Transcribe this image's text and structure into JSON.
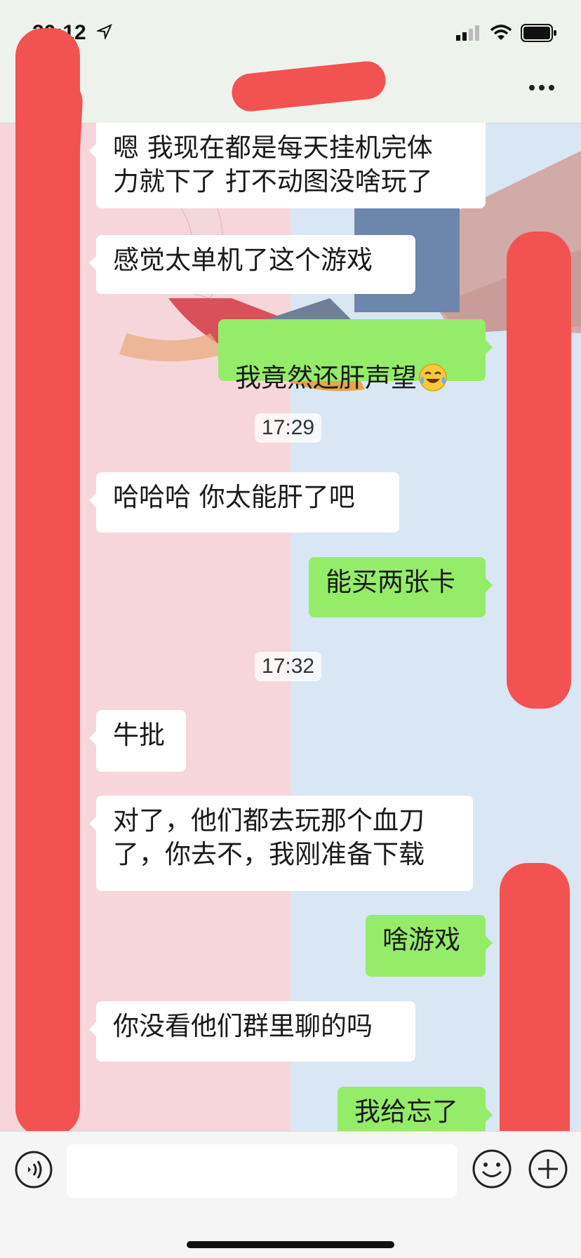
{
  "status_bar": {
    "time": "20:12"
  },
  "chat": {
    "messages": [
      {
        "side": "left",
        "text": "嗯 我现在都是每天挂机完体\n力就下了 打不动图没啥玩了"
      },
      {
        "side": "left",
        "text": "感觉太单机了这个游戏"
      },
      {
        "side": "right",
        "text": "我竟然还肝声望",
        "emoji": "laughing-crying-emoji"
      },
      {
        "side": "time",
        "text": "17:29"
      },
      {
        "side": "left",
        "text": "哈哈哈 你太能肝了吧"
      },
      {
        "side": "right",
        "text": "能买两张卡"
      },
      {
        "side": "time",
        "text": "17:32"
      },
      {
        "side": "left",
        "text": "牛批"
      },
      {
        "side": "left",
        "text": "对了，他们都去玩那个血刀\n了，你去不，我刚准备下载"
      },
      {
        "side": "right",
        "text": "啥游戏"
      },
      {
        "side": "left",
        "text": "你没看他们群里聊的吗"
      },
      {
        "side": "right",
        "text": "我给忘了"
      }
    ]
  },
  "colors": {
    "incoming_bubble": "#ffffff",
    "outgoing_bubble": "#95ec69",
    "redaction": "#f25252"
  },
  "icons": [
    "location-arrow-icon",
    "signal-icon",
    "wifi-icon",
    "battery-icon",
    "more-icon",
    "voice-icon",
    "emoji-icon",
    "plus-icon"
  ]
}
